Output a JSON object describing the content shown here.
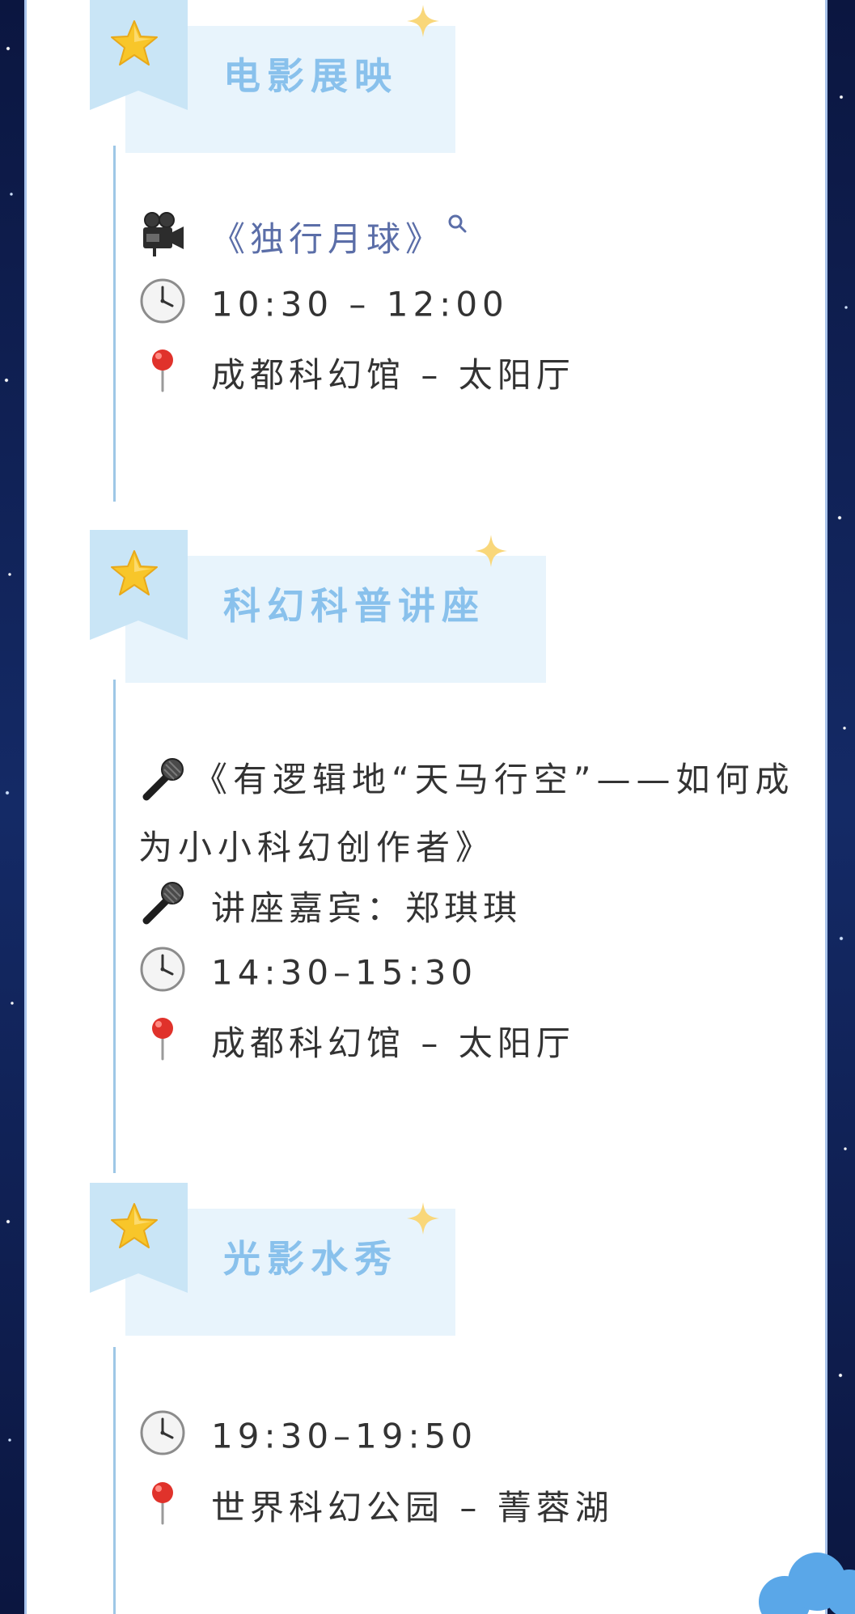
{
  "sections": [
    {
      "title": "电影展映",
      "film": "《独行月球》",
      "time": "10:30 – 12:00",
      "location": "成都科幻馆 – 太阳厅"
    },
    {
      "title": "科幻科普讲座",
      "lecture_title": "《有逻辑地“天马行空”——如何成为小小科幻创作者》",
      "speaker": "讲座嘉宾：郑琪琪",
      "time": "14:30–15:30",
      "location": "成都科幻馆 – 太阳厅"
    },
    {
      "title": "光影水秀",
      "time": "19:30–19:50",
      "location": "世界科幻公园 – 菁蓉湖"
    }
  ],
  "icons": {
    "header": "star-icon",
    "decoration": "sparkle-icon",
    "film": "movie-camera-icon",
    "search": "search-icon",
    "time": "clock-icon",
    "location": "map-pin-icon",
    "speaker": "microphone-icon"
  },
  "colors": {
    "accent_title": "#89c1ec",
    "tag_background": "#e8f4fc",
    "timeline": "#9ec7e6",
    "text": "#333333",
    "link": "#5b6ea8",
    "border": "#0d1a4a"
  }
}
